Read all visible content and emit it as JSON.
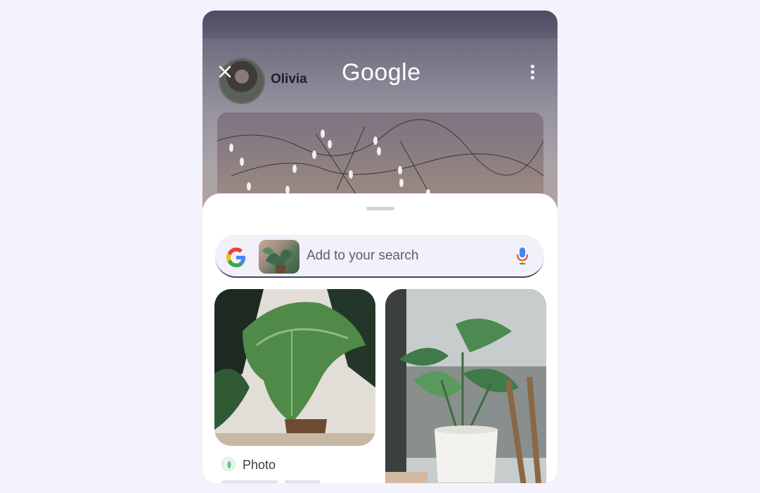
{
  "header": {
    "user_name": "Olivia",
    "logo_text": "Google",
    "close_icon": "close-icon",
    "menu_icon": "more-vert-icon"
  },
  "search": {
    "placeholder": "Add to your search",
    "mic_icon": "mic-icon",
    "google_icon": "google-g-icon"
  },
  "results": [
    {
      "label": "Photo",
      "icon": "leaf-icon"
    }
  ],
  "colors": {
    "background": "#f3f2fd",
    "sheet": "#ffffff",
    "search_bar": "#f2f0f9"
  }
}
